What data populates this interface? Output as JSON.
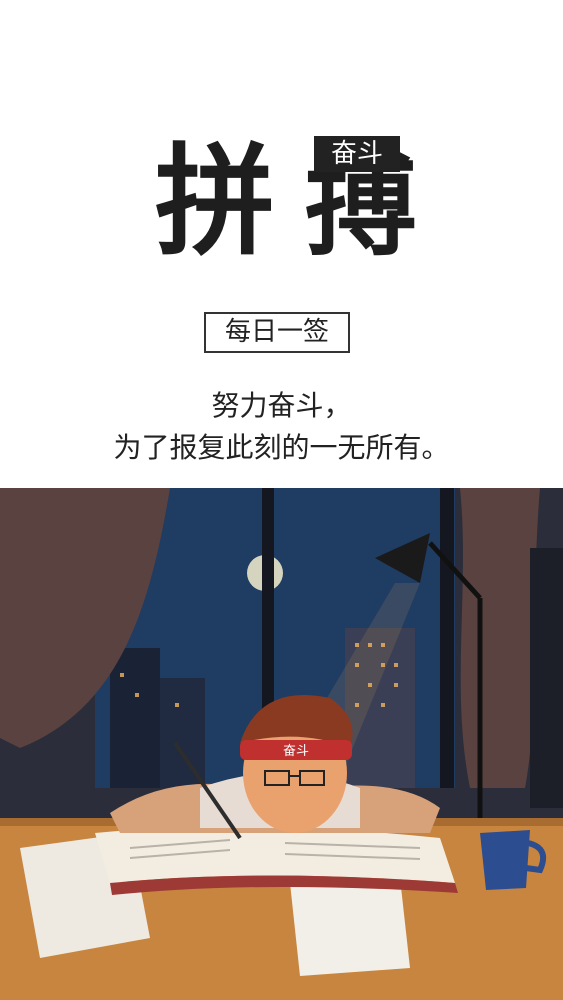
{
  "header": {
    "big_char_1": "拼",
    "big_char_2": "搏",
    "tag": "奋斗"
  },
  "badge": {
    "label": "每日一签"
  },
  "quote": {
    "line1": "努力奋斗，",
    "line2": "为了报复此刻的一无所有。"
  },
  "illustration": {
    "headband_text": "奋斗",
    "colors": {
      "sky": "#1e3a5e",
      "wall": "#2c2f3d",
      "desk": "#c8853f",
      "lamp_glow": "#f3b25a",
      "curtain": "#5a4240",
      "headband": "#c0302e",
      "mug": "#2c4d8f"
    }
  }
}
